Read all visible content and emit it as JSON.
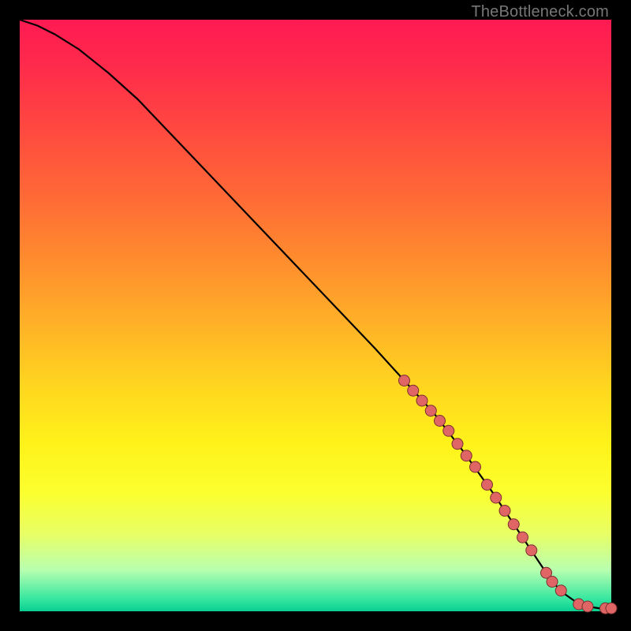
{
  "watermark": "TheBottleneck.com",
  "colors": {
    "line": "#000000",
    "marker_fill": "#e06666",
    "marker_stroke": "#7a2e2e"
  },
  "chart_data": {
    "type": "line",
    "title": "",
    "xlabel": "",
    "ylabel": "",
    "xlim": [
      0,
      100
    ],
    "ylim": [
      0,
      100
    ],
    "grid": false,
    "legend": false,
    "series": [
      {
        "name": "curve",
        "x": [
          0,
          3,
          6,
          10,
          15,
          20,
          30,
          40,
          50,
          60,
          65,
          70,
          75,
          80,
          85,
          88,
          90,
          92,
          94,
          96,
          98,
          100
        ],
        "y": [
          100,
          99,
          97.5,
          95,
          91,
          86.5,
          76,
          65.5,
          55,
          44.5,
          39,
          33.5,
          27,
          20,
          12.5,
          8,
          5,
          3,
          1.6,
          0.8,
          0.5,
          0.5
        ]
      }
    ],
    "markers": [
      {
        "x": 65.0,
        "y": 39.0
      },
      {
        "x": 66.5,
        "y": 37.3
      },
      {
        "x": 68.0,
        "y": 35.6
      },
      {
        "x": 69.5,
        "y": 33.9
      },
      {
        "x": 71.0,
        "y": 32.2
      },
      {
        "x": 72.5,
        "y": 30.5
      },
      {
        "x": 74.0,
        "y": 28.3
      },
      {
        "x": 75.5,
        "y": 26.3
      },
      {
        "x": 77.0,
        "y": 24.4
      },
      {
        "x": 79.0,
        "y": 21.4
      },
      {
        "x": 80.5,
        "y": 19.2
      },
      {
        "x": 82.0,
        "y": 17.0
      },
      {
        "x": 83.5,
        "y": 14.7
      },
      {
        "x": 85.0,
        "y": 12.5
      },
      {
        "x": 86.5,
        "y": 10.3
      },
      {
        "x": 89.0,
        "y": 6.5
      },
      {
        "x": 90.0,
        "y": 5.0
      },
      {
        "x": 91.5,
        "y": 3.5
      },
      {
        "x": 94.5,
        "y": 1.2
      },
      {
        "x": 96.0,
        "y": 0.8
      },
      {
        "x": 99.0,
        "y": 0.5
      },
      {
        "x": 100.0,
        "y": 0.5
      }
    ],
    "marker_radius_px": 7
  }
}
